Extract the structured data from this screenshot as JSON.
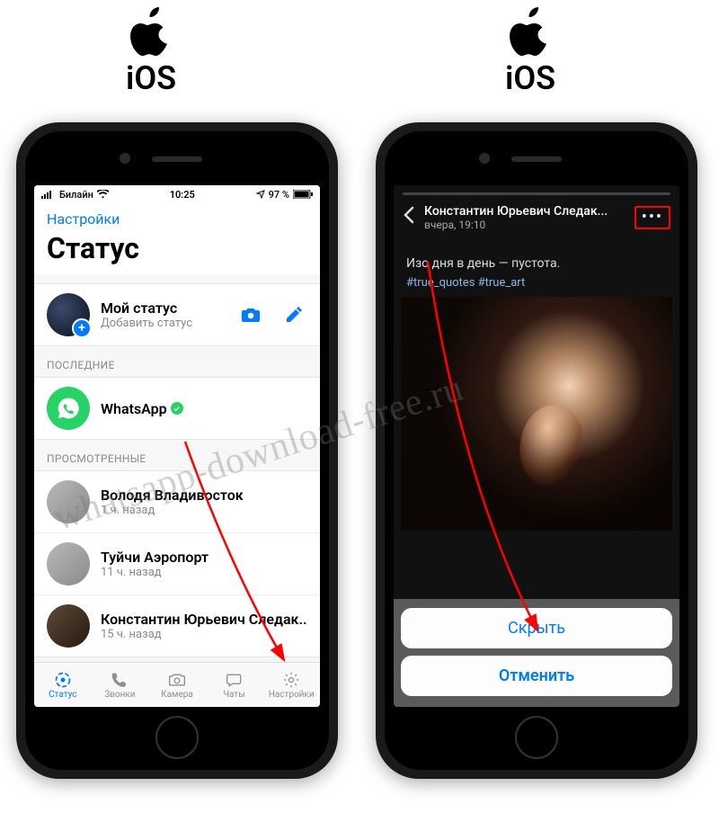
{
  "labels": {
    "ios": "iOS"
  },
  "watermark": "whatsapp-download-free.ru",
  "left": {
    "statusbar": {
      "carrier": "Билайн",
      "time": "10:25",
      "battery": "97 %"
    },
    "nav": {
      "back": "Настройки",
      "title": "Статус"
    },
    "my_status": {
      "title": "Мой статус",
      "subtitle": "Добавить статус"
    },
    "sections": {
      "recent_label": "ПОСЛЕДНИЕ",
      "viewed_label": "ПРОСМОТРЕННЫЕ"
    },
    "recent": [
      {
        "name": "WhatsApp",
        "verified": true
      }
    ],
    "viewed": [
      {
        "name": "Володя Владивосток",
        "time": "1 ч. назад"
      },
      {
        "name": "Туйчи Аэропорт",
        "time": "11 ч. назад"
      },
      {
        "name": "Константин Юрьевич Следак...",
        "time": "15 ч. назад"
      }
    ],
    "tabs": {
      "status": "Статус",
      "calls": "Звонки",
      "camera": "Камера",
      "chats": "Чаты",
      "settings": "Настройки"
    }
  },
  "right": {
    "header": {
      "name": "Константин Юрьевич Следак...",
      "time": "вчера, 19:10"
    },
    "caption": "Изо дня в день — пустота.",
    "tags": "#true_quotes #true_art",
    "sheet": {
      "hide": "Скрыть",
      "cancel": "Отменить"
    }
  }
}
